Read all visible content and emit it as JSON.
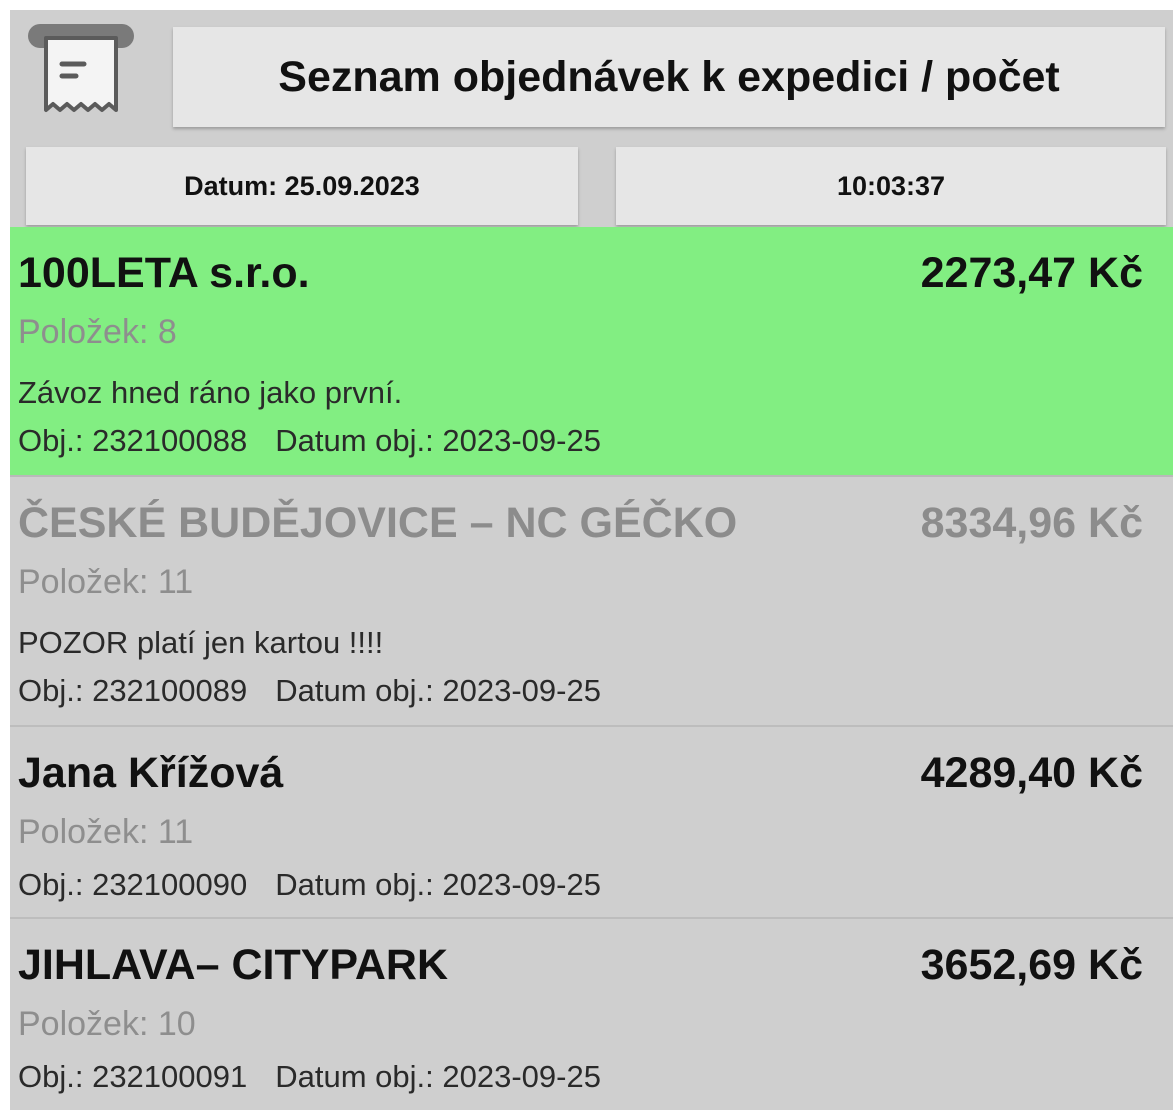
{
  "header": {
    "icon": "receipt-icon",
    "title": "Seznam objednávek k expedici / počet",
    "date_label": "Datum: 25.09.2023",
    "time_label": "10:03:37"
  },
  "colors": {
    "selected_row": "#82ee82",
    "background": "#cfcfcf",
    "button": "#e6e6e6",
    "muted_text": "#8e8e8e"
  },
  "orders": [
    {
      "name": "100LETA s.r.o.",
      "amount": "2273,47 Kč",
      "items": "Položek: 8",
      "note": "Závoz hned ráno jako první.",
      "order_no": "Obj.: 232100088",
      "order_date": "Datum obj.: 2023-09-25",
      "state": "selected"
    },
    {
      "name": "ČESKÉ BUDĚJOVICE – NC GÉČKO",
      "amount": "8334,96 Kč",
      "items": "Položek: 11",
      "note": "POZOR platí jen kartou !!!!",
      "order_no": "Obj.: 232100089",
      "order_date": "Datum obj.: 2023-09-25",
      "state": "disabled"
    },
    {
      "name": "Jana Křížová",
      "amount": "4289,40 Kč",
      "items": "Položek: 11",
      "note": "",
      "order_no": "Obj.: 232100090",
      "order_date": "Datum obj.: 2023-09-25",
      "state": "normal"
    },
    {
      "name": "JIHLAVA– CITYPARK",
      "amount": "3652,69 Kč",
      "items": "Položek: 10",
      "note": "",
      "order_no": "Obj.: 232100091",
      "order_date": "Datum obj.: 2023-09-25",
      "state": "normal"
    }
  ]
}
